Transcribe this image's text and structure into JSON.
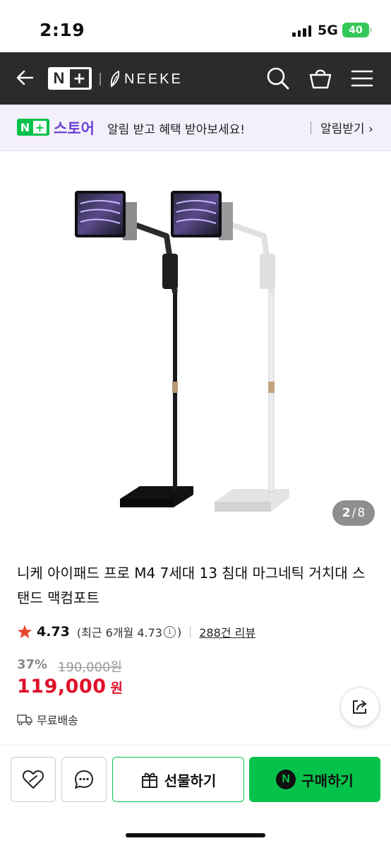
{
  "status": {
    "time": "2:19",
    "network": "5G",
    "battery": "40"
  },
  "header": {
    "logo_n": "N",
    "logo_plus": "+",
    "brand": "NEEKE",
    "icons": [
      "back-arrow-icon",
      "search-icon",
      "shopping-bag-icon",
      "menu-icon"
    ]
  },
  "promo": {
    "badge_n": "N",
    "badge_plus": "+",
    "store": "스토어",
    "text": "알림 받고 혜택 받아보세요!",
    "action": "알림받기 ›"
  },
  "gallery": {
    "current": "2",
    "separator": "/",
    "total": "8"
  },
  "product": {
    "title": "니케 아이패드 프로 M4 7세대 13 침대 마그네틱 거치대 스탠드 맥컴포트",
    "rating": "4.73",
    "rating_recent_prefix": "(최근 6개월 4.73",
    "rating_recent_suffix": ")",
    "reviews": "288건 리뷰",
    "discount": "37%",
    "original_price": "190,000원",
    "price": "119,000",
    "price_unit": "원",
    "shipping": "무료배송"
  },
  "bottom": {
    "gift": "선물하기",
    "buy": "구매하기",
    "npay": "N"
  },
  "colors": {
    "header_bg": "#2b2b2b",
    "naver_green": "#05c24a",
    "store_purple": "#6b3fd4",
    "price_red": "#e0102a",
    "star": "#e8452c"
  }
}
